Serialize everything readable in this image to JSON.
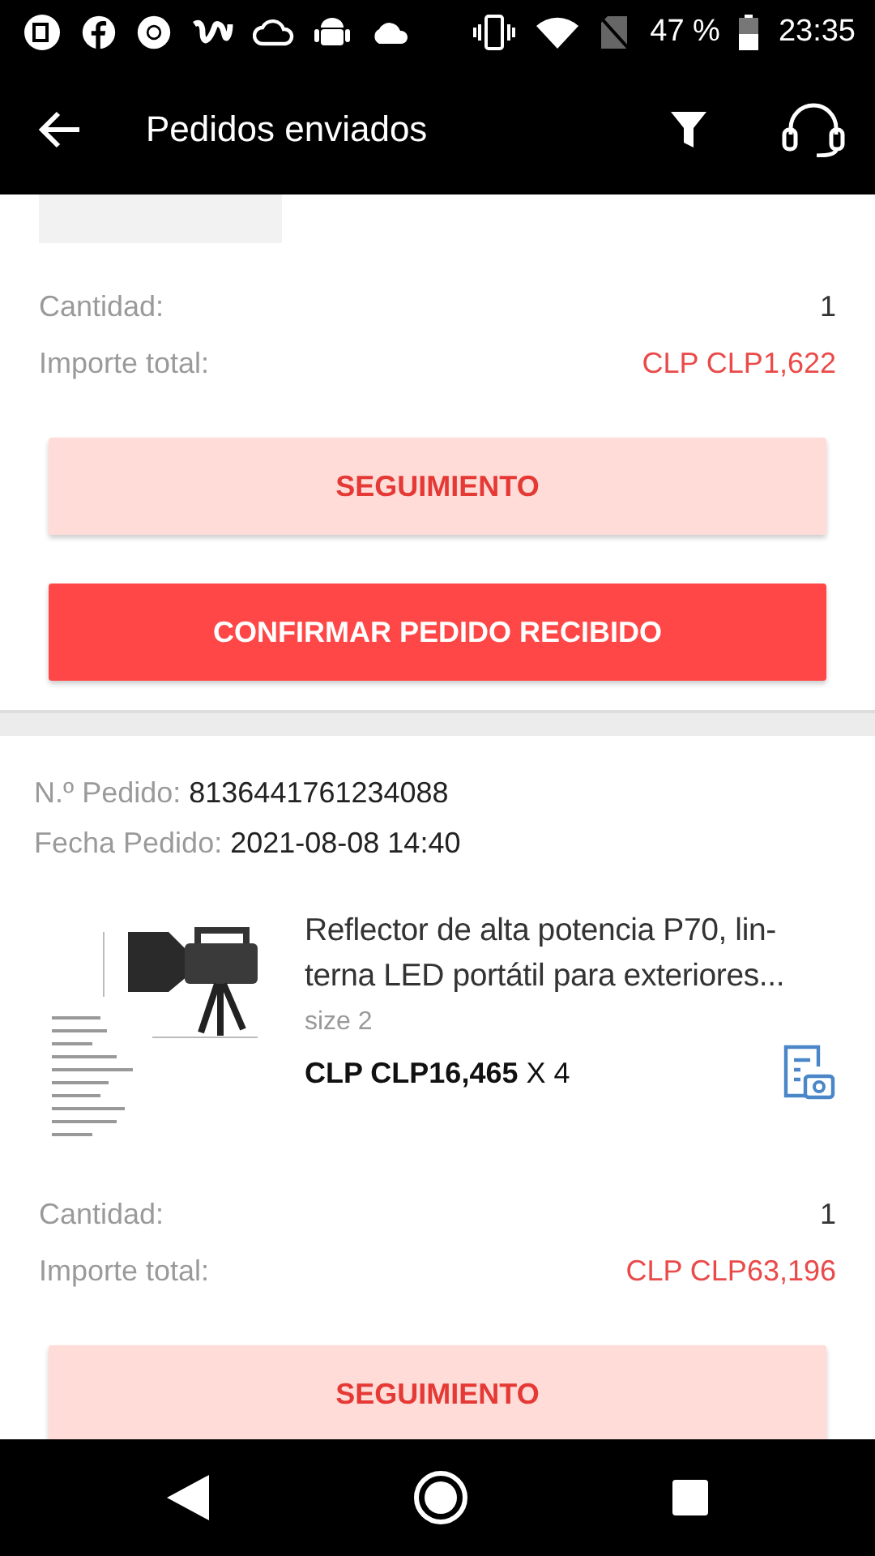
{
  "status_bar": {
    "battery": "47 %",
    "time": "23:35"
  },
  "app_bar": {
    "title": "Pedidos enviados"
  },
  "orders": [
    {
      "product": {
        "image": {
          "kind": "blank"
        }
      },
      "quantity_label": "Cantidad:",
      "quantity": "1",
      "total_label": "Importe total:",
      "total": "CLP CLP1,622",
      "buttons": [
        {
          "label": "SEGUIMIENTO",
          "kind": "secondary"
        },
        {
          "label": "CONFIRMAR PEDIDO RECIBIDO",
          "kind": "primary"
        }
      ]
    },
    {
      "number_label": "N.º Pedido:",
      "number": "8136441761234088",
      "date_label": "Fecha Pedido:",
      "date": "2021-08-08 14:40",
      "product": {
        "title": "Reflector de alta potencia P70, lin-terna LED portátil para exteriores...",
        "variant": "size 2",
        "price": "**CLP CLP16,465** X 4"
      },
      "quantity_label": "Cantidad:",
      "quantity": "1",
      "total_label": "Importe total:",
      "total": "CLP CLP63,196",
      "buttons": [
        {
          "label": "SEGUIMIENTO",
          "kind": "secondary"
        }
      ]
    }
  ]
}
